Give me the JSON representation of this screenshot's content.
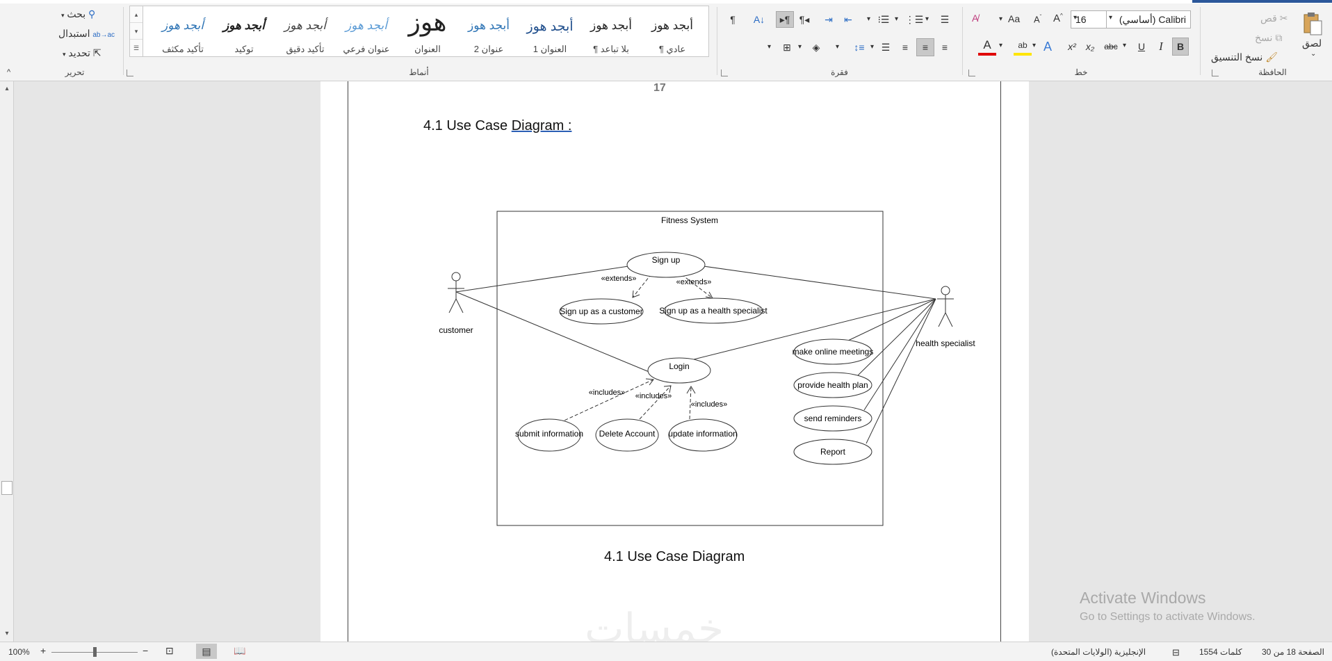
{
  "ribbon": {
    "clipboard": {
      "label": "الحافظة",
      "paste": "لصق",
      "cut": "قص",
      "copy": "نسخ",
      "format_painter": "نسخ التنسيق"
    },
    "font": {
      "label": "خط",
      "font_name": "Calibri (أساسي)",
      "font_size": "16",
      "bold": "B",
      "italic": "I",
      "underline": "U",
      "strike": "abc",
      "subscript": "x₂",
      "superscript": "x²",
      "grow": "A",
      "shrink": "A",
      "change_case": "Aa"
    },
    "paragraph": {
      "label": "فقرة"
    },
    "styles": {
      "label": "أنماط",
      "items": [
        {
          "sample": "أبجد هوز",
          "name": "¶ عادي"
        },
        {
          "sample": "أبجد هوز",
          "name": "¶ بلا تباعد"
        },
        {
          "sample": "أبجد هوز",
          "name": "العنوان 1"
        },
        {
          "sample": "أبجد هوز",
          "name": "عنوان 2"
        },
        {
          "sample": "هوز",
          "name": "العنوان"
        },
        {
          "sample": "أبجد هوز",
          "name": "عنوان فرعي"
        },
        {
          "sample": "أبجد هوز",
          "name": "تأكيد دقيق"
        },
        {
          "sample": "أبجد هوز",
          "name": "توكيد"
        },
        {
          "sample": "أبجد هوز",
          "name": "تأكيد مكثف"
        }
      ]
    },
    "editing": {
      "label": "تحرير",
      "find": "بحث",
      "replace": "استبدال",
      "select": "تحديد"
    }
  },
  "document": {
    "page_number": "17",
    "heading_prefix": "4.1 Use Case ",
    "heading_link": "Diagram :",
    "caption": "4.1 Use Case Diagram",
    "watermark": "خمسات"
  },
  "diagram": {
    "system_title": "Fitness System",
    "actors": {
      "customer": "customer",
      "specialist": "health specialist"
    },
    "use_cases": {
      "sign_up": "Sign up",
      "sign_up_customer": "Sign up as a customer",
      "sign_up_specialist": "Sign up as a health specialist",
      "login": "Login",
      "submit_information": "submit information",
      "delete_account": "Delete Account",
      "update_information": "update information",
      "online_meetings": "make online meetings",
      "health_plan": "provide health plan",
      "reminders": "send reminders",
      "report": "Report"
    },
    "relations": {
      "extends": "«extends»",
      "includes": "«includes»"
    }
  },
  "activation": {
    "title": "Activate Windows",
    "subtitle": "Go to Settings to activate Windows."
  },
  "statusbar": {
    "page_info": "الصفحة 18 من 30",
    "word_count": "1554 كلمات",
    "language": "الإنجليزية (الولايات المتحدة)",
    "zoom": "100%",
    "zoom_in": "+",
    "zoom_out": "−"
  }
}
